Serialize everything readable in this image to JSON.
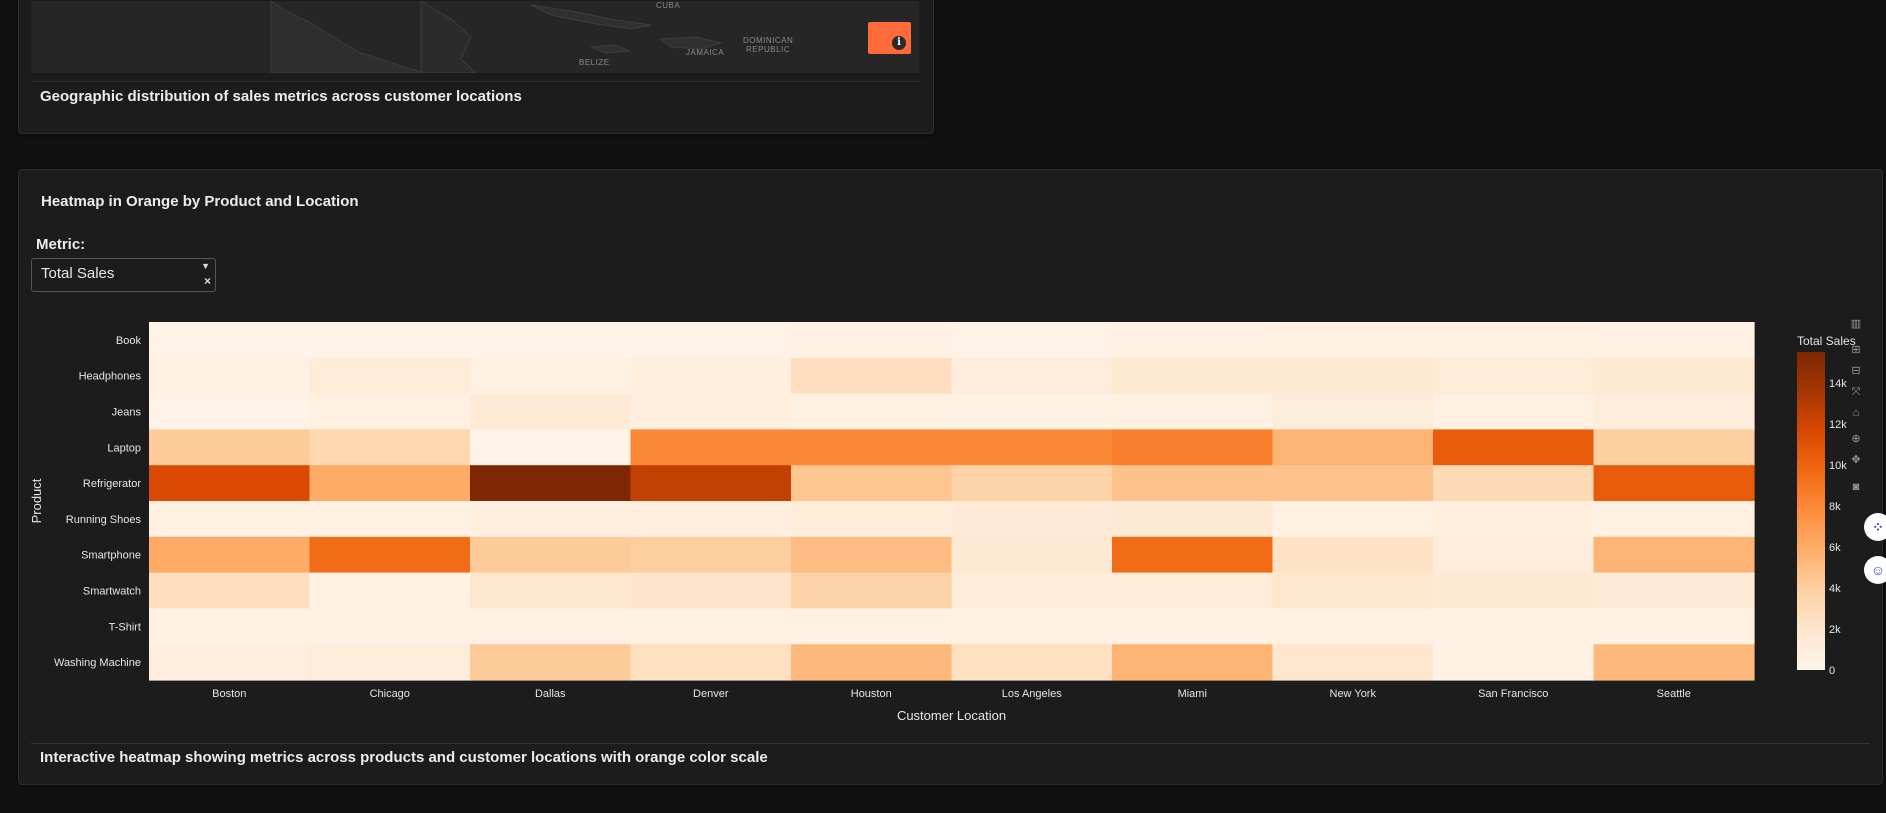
{
  "map_card": {
    "labels": [
      "CUBA",
      "DOMINICAN",
      "REPUBLIC",
      "JAMAICA",
      "BELIZE"
    ],
    "caption": "Geographic distribution of sales metrics across customer locations",
    "marker_color": "#ff6a3a",
    "info_icon": "i"
  },
  "heatmap_card": {
    "title": "Heatmap in Orange by Product and Location",
    "metric_label": "Metric:",
    "metric_value": "Total Sales",
    "caption": "Interactive heatmap showing metrics across products and customer locations with orange color scale"
  },
  "modebar": [
    "bar-chart-icon",
    "zoom-in-icon",
    "zoom-out-icon",
    "autoscale-icon",
    "home-icon",
    "zoom-icon",
    "pan-icon",
    "camera-icon"
  ],
  "chart_data": {
    "type": "heatmap",
    "xlabel": "Customer Location",
    "ylabel": "Product",
    "colorbar_title": "Total Sales",
    "colorscale": [
      "#fff5eb",
      "#fee6ce",
      "#fdd0a2",
      "#fdae6b",
      "#fd8d3c",
      "#f16913",
      "#d94801",
      "#a63603",
      "#7f2704"
    ],
    "zlim": [
      0,
      15500
    ],
    "colorbar_ticks": [
      0,
      2000,
      4000,
      6000,
      8000,
      10000,
      12000,
      14000
    ],
    "colorbar_tick_labels": [
      "0",
      "2k",
      "4k",
      "6k",
      "8k",
      "10k",
      "12k",
      "14k"
    ],
    "x": [
      "Boston",
      "Chicago",
      "Dallas",
      "Denver",
      "Houston",
      "Los Angeles",
      "Miami",
      "New York",
      "San Francisco",
      "Seattle"
    ],
    "y": [
      "Book",
      "Headphones",
      "Jeans",
      "Laptop",
      "Refrigerator",
      "Running Shoes",
      "Smartphone",
      "Smartwatch",
      "T-Shirt",
      "Washing Machine"
    ],
    "z": [
      [
        300,
        250,
        300,
        350,
        400,
        300,
        400,
        600,
        700,
        400
      ],
      [
        500,
        1200,
        700,
        800,
        2600,
        1000,
        1600,
        1600,
        1300,
        1600
      ],
      [
        300,
        700,
        1400,
        900,
        600,
        500,
        700,
        1100,
        700,
        1000
      ],
      [
        4200,
        3300,
        300,
        8000,
        8000,
        8000,
        8500,
        5500,
        10500,
        4000
      ],
      [
        11500,
        6000,
        15500,
        12500,
        4500,
        3700,
        4700,
        4700,
        3100,
        10500
      ],
      [
        600,
        600,
        800,
        900,
        1200,
        1400,
        1500,
        700,
        800,
        700
      ],
      [
        6000,
        9500,
        4200,
        4000,
        5000,
        1600,
        9500,
        2300,
        1100,
        5500
      ],
      [
        2600,
        500,
        2000,
        2100,
        3700,
        1300,
        1200,
        2000,
        1600,
        1400
      ],
      [
        500,
        500,
        600,
        700,
        700,
        700,
        700,
        700,
        500,
        600
      ],
      [
        900,
        1100,
        4200,
        2500,
        5200,
        2500,
        5500,
        1900,
        400,
        5200
      ]
    ]
  }
}
